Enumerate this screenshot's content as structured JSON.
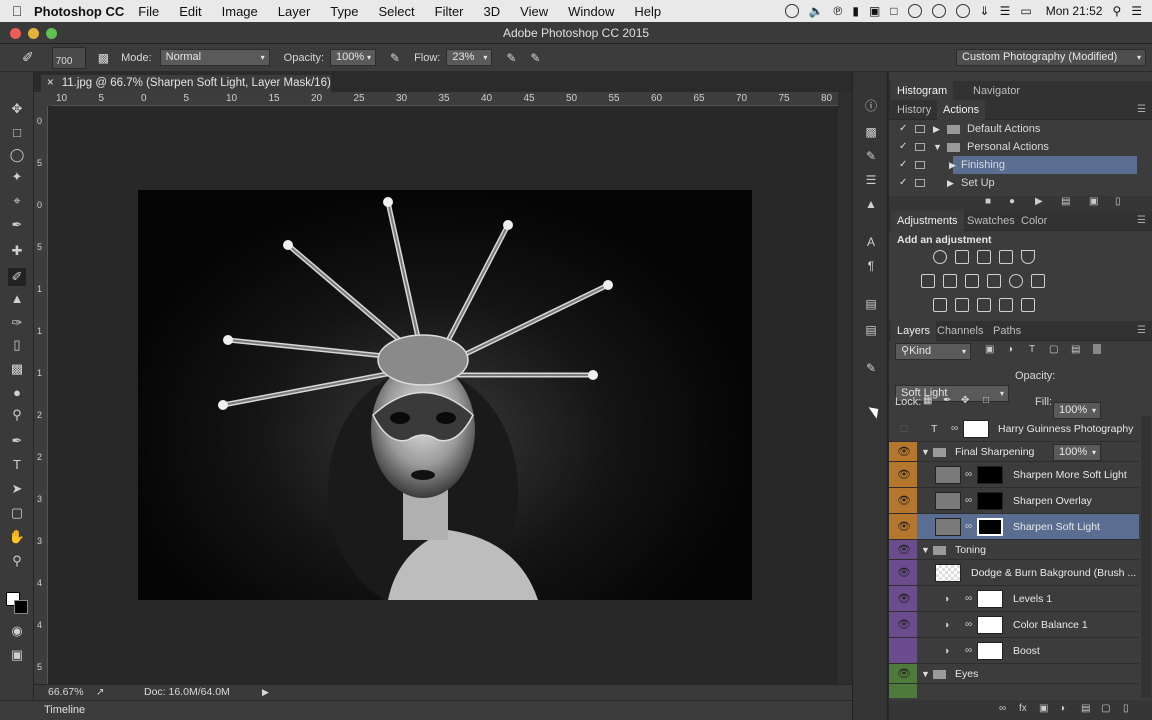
{
  "menubar": {
    "app": "Photoshop CC",
    "items": [
      "File",
      "Edit",
      "Image",
      "Layer",
      "Type",
      "Select",
      "Filter",
      "3D",
      "View",
      "Window",
      "Help"
    ],
    "clock": "Mon 21:52"
  },
  "window": {
    "title": "Adobe Photoshop CC 2015"
  },
  "options": {
    "brush_size": "700",
    "mode_label": "Mode:",
    "mode_value": "Normal",
    "opacity_label": "Opacity:",
    "opacity_value": "100%",
    "flow_label": "Flow:",
    "flow_value": "23%",
    "workspace": "Custom Photography (Modified)"
  },
  "document": {
    "close": "×",
    "tab_title": "11.jpg @ 66.7% (Sharpen Soft Light, Layer Mask/16) *"
  },
  "ruler": {
    "h_ticks": [
      "10",
      "5",
      "0",
      "5",
      "10",
      "15",
      "20",
      "25",
      "30",
      "35",
      "40",
      "45",
      "50",
      "55",
      "60",
      "65",
      "70",
      "75",
      "80"
    ],
    "v_ticks": [
      "0",
      "5",
      "0",
      "5",
      "1",
      "1",
      "1",
      "2",
      "2",
      "3",
      "3",
      "4",
      "4",
      "5",
      "5"
    ]
  },
  "status": {
    "zoom": "66.67%",
    "doc": "Doc: 16.0M/64.0M"
  },
  "timeline": {
    "label": "Timeline"
  },
  "panels": {
    "histogram_tabs": [
      "Histogram",
      "Navigator"
    ],
    "history_tabs": [
      "History",
      "Actions"
    ],
    "actions": [
      {
        "name": "Default Actions"
      },
      {
        "name": "Personal Actions"
      },
      {
        "name": "Finishing"
      },
      {
        "name": "Set Up"
      }
    ],
    "adjust_tabs": [
      "Adjustments",
      "Swatches",
      "Color"
    ],
    "adjust_title": "Add an adjustment",
    "layers_tabs": [
      "Layers",
      "Channels",
      "Paths"
    ],
    "kind_filter": "Kind",
    "blend_mode": "Soft Light",
    "opacity_label": "Opacity:",
    "opacity_value": "100%",
    "lock_label": "Lock:",
    "fill_label": "Fill:",
    "fill_value": "100%",
    "layers": [
      {
        "name": "Harry Guinness Photography"
      },
      {
        "name": "Final Sharpening"
      },
      {
        "name": "Sharpen More Soft Light"
      },
      {
        "name": "Sharpen Overlay"
      },
      {
        "name": "Sharpen Soft Light"
      },
      {
        "name": "Toning"
      },
      {
        "name": "Dodge & Burn Bakground (Brush ..."
      },
      {
        "name": "Levels 1"
      },
      {
        "name": "Color Balance 1"
      },
      {
        "name": "Boost"
      },
      {
        "name": "Eyes"
      }
    ]
  },
  "colors": {
    "orange_label": "#b5772d",
    "purple_label": "#6b4c8c",
    "green_label": "#4e7a3a",
    "selection": "#5a6e92"
  }
}
